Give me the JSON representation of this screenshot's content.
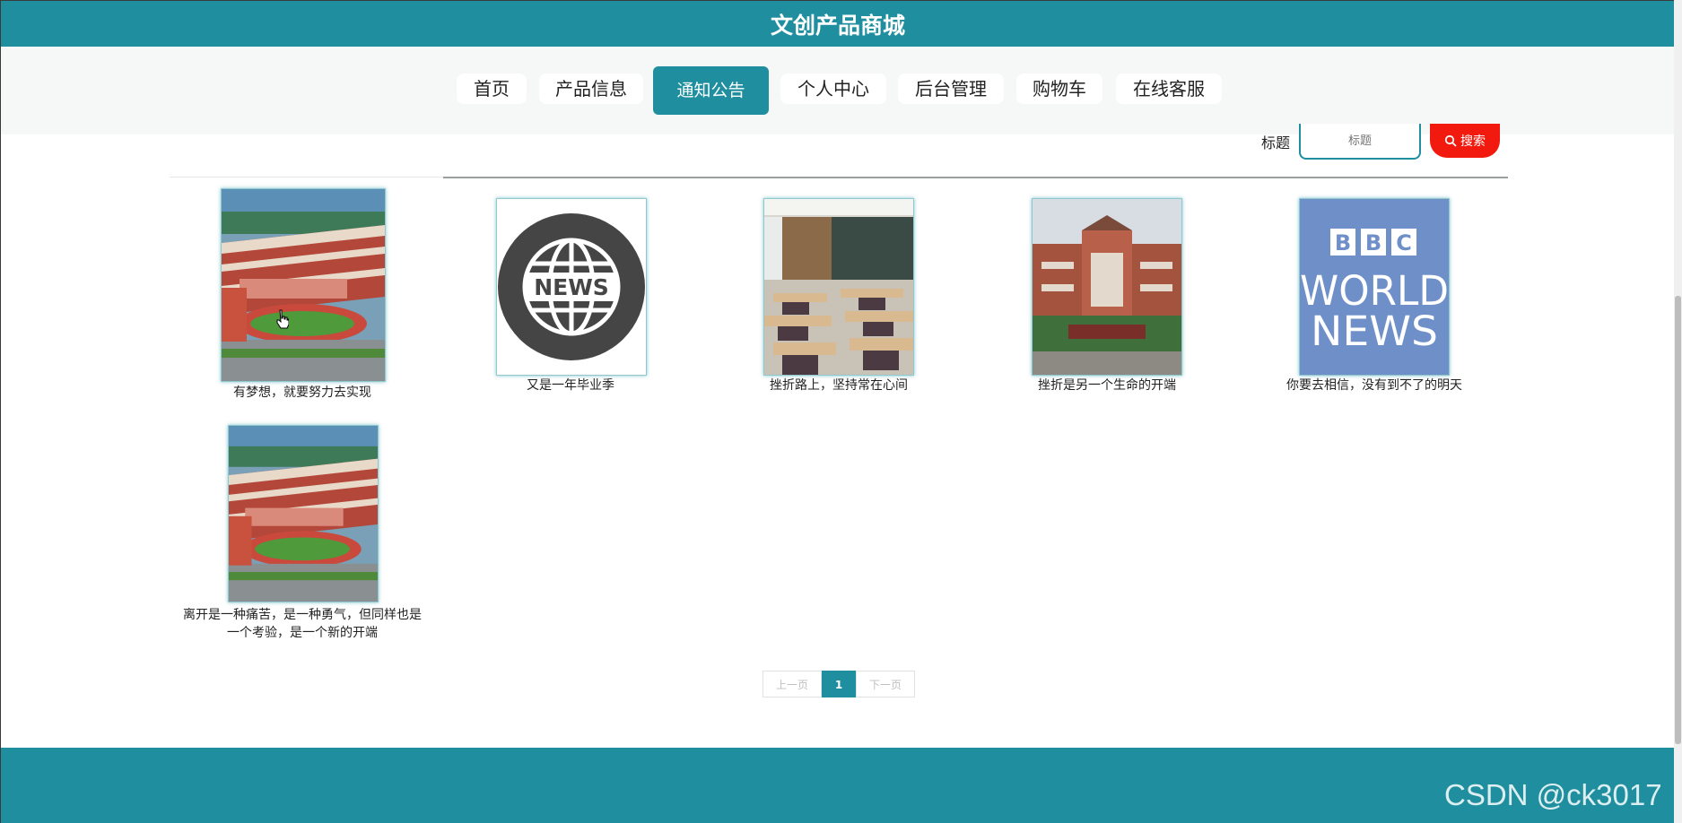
{
  "app": {
    "title": "文创产品商城"
  },
  "nav": {
    "items": [
      "首页",
      "产品信息",
      "通知公告",
      "个人中心",
      "后台管理",
      "购物车",
      "在线客服"
    ],
    "active": "通知公告"
  },
  "search": {
    "label": "标题",
    "placeholder": "标题",
    "button_label": "搜索"
  },
  "notices": [
    {
      "caption": "有梦想，就要努力去实现",
      "image": "school-campus-aerial"
    },
    {
      "caption": "又是一年毕业季",
      "image": "news-globe-icon"
    },
    {
      "caption": "挫折路上，坚持常在心间",
      "image": "classroom-desks"
    },
    {
      "caption": "挫折是另一个生命的开端",
      "image": "school-building-front"
    },
    {
      "caption": "你要去相信，没有到不了的明天",
      "image": "bbc-world-news-logo"
    },
    {
      "caption": "离开是一种痛苦，是一种勇气，但同样也是一个考验，是一个新的开端",
      "image": "school-campus-aerial"
    }
  ],
  "news_icon_text": "NEWS",
  "bbc_logo": {
    "letters": [
      "B",
      "B",
      "C"
    ],
    "line1": "WORLD",
    "line2": "NEWS"
  },
  "pagination": {
    "prev": "上一页",
    "current": "1",
    "next": "下一页"
  },
  "watermark": "CSDN @ck3017",
  "colors": {
    "primary": "#1f8fa0",
    "search_button": "#f21a0e",
    "bbc_blue": "#6e8fc8"
  }
}
